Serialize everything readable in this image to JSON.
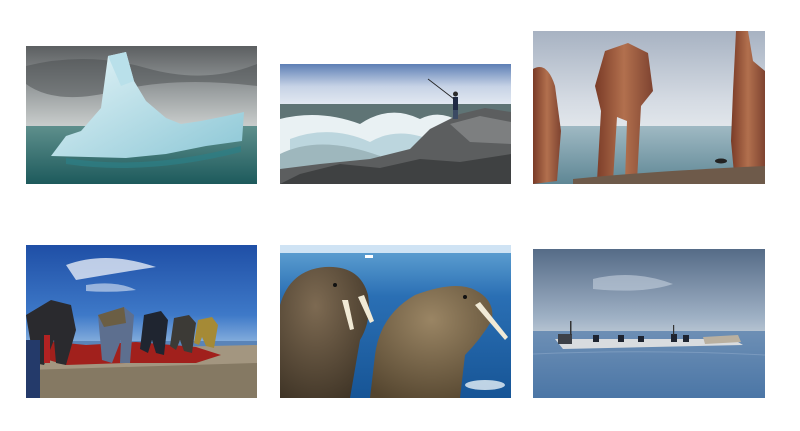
{
  "gallery": {
    "photos": [
      {
        "subject": "iceberg"
      },
      {
        "subject": "fisherman-on-rocks"
      },
      {
        "subject": "rock-arch"
      },
      {
        "subject": "people-on-beach"
      },
      {
        "subject": "walruses"
      },
      {
        "subject": "boat-on-sea"
      }
    ]
  },
  "colors": {
    "background": "#ffffff",
    "sea_teal": "#2f6f6e",
    "sky_blue": "#2f62b8",
    "rock_red": "#9a5a3e"
  }
}
